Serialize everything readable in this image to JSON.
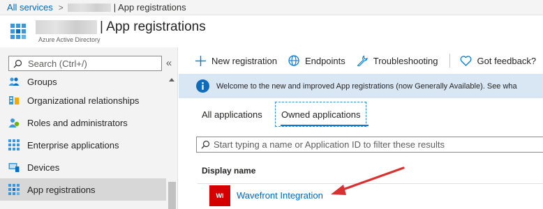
{
  "breadcrumb": {
    "root": "All services",
    "current": "| App registrations"
  },
  "header": {
    "title": "| App registrations",
    "subtitle": "Azure Active Directory"
  },
  "sidebar": {
    "search_placeholder": "Search (Ctrl+/)",
    "collapse_glyph": "«",
    "items": [
      {
        "label": "Groups",
        "icon": "groups-icon"
      },
      {
        "label": "Organizational relationships",
        "icon": "org-relationships-icon"
      },
      {
        "label": "Roles and administrators",
        "icon": "roles-icon"
      },
      {
        "label": "Enterprise applications",
        "icon": "enterprise-apps-icon"
      },
      {
        "label": "Devices",
        "icon": "devices-icon"
      },
      {
        "label": "App registrations",
        "icon": "app-registrations-icon",
        "active": true
      }
    ]
  },
  "toolbar": {
    "new_registration": "New registration",
    "endpoints": "Endpoints",
    "troubleshooting": "Troubleshooting",
    "feedback": "Got feedback?"
  },
  "banner": {
    "text": "Welcome to the new and improved App registrations (now Generally Available). See wha"
  },
  "tabs": {
    "all": "All applications",
    "owned": "Owned applications",
    "active": "owned"
  },
  "filter": {
    "placeholder": "Start typing a name or Application ID to filter these results",
    "value": ""
  },
  "table": {
    "column_display_name": "Display name",
    "rows": [
      {
        "badge": "WI",
        "badge_color": "#d40000",
        "name": "Wavefront Integration"
      }
    ]
  },
  "colors": {
    "accent": "#0078d4",
    "link": "#0067b8",
    "banner_bg": "#d9e6f4",
    "annotation_arrow": "#d93030"
  }
}
